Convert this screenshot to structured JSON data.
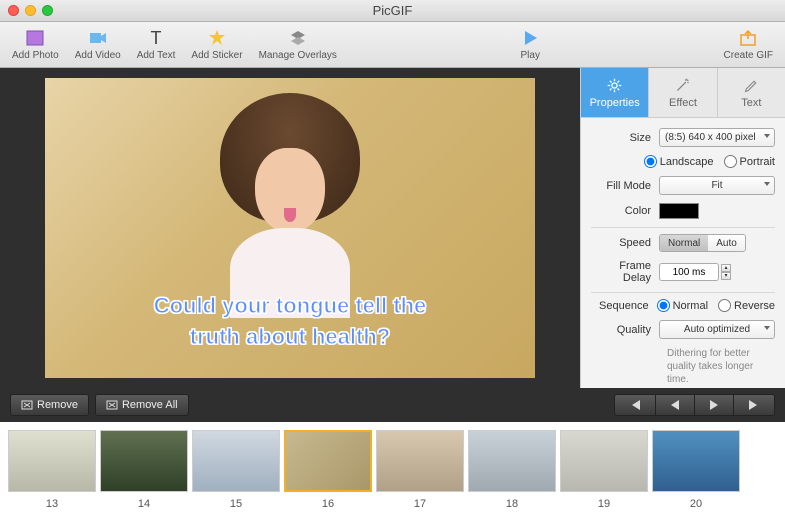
{
  "app": {
    "title": "PicGIF"
  },
  "toolbar": {
    "addPhoto": "Add Photo",
    "addVideo": "Add Video",
    "addText": "Add Text",
    "addSticker": "Add Sticker",
    "manageOverlays": "Manage Overlays",
    "play": "Play",
    "createGif": "Create GIF"
  },
  "preview": {
    "captionLine1": "Could your tongue tell the",
    "captionLine2": "truth about health?"
  },
  "tabs": {
    "properties": "Properties",
    "effect": "Effect",
    "text": "Text"
  },
  "props": {
    "sizeLabel": "Size",
    "sizeValue": "(8:5) 640 x 400 pixel",
    "landscape": "Landscape",
    "portrait": "Portrait",
    "fillModeLabel": "Fill Mode",
    "fillModeValue": "Fit",
    "colorLabel": "Color",
    "colorValue": "#000000",
    "speedLabel": "Speed",
    "speedNormal": "Normal",
    "speedAuto": "Auto",
    "frameDelayLabel": "Frame Delay",
    "frameDelayValue": "100 ms",
    "sequenceLabel": "Sequence",
    "seqNormal": "Normal",
    "seqReverse": "Reverse",
    "qualityLabel": "Quality",
    "qualityValue": "Auto optimized",
    "qualityHint": "Dithering for better quality takes longer time."
  },
  "controls": {
    "remove": "Remove",
    "removeAll": "Remove All"
  },
  "frames": [
    {
      "n": "13"
    },
    {
      "n": "14"
    },
    {
      "n": "15"
    },
    {
      "n": "16",
      "selected": true
    },
    {
      "n": "17"
    },
    {
      "n": "18"
    },
    {
      "n": "19"
    },
    {
      "n": "20"
    }
  ]
}
